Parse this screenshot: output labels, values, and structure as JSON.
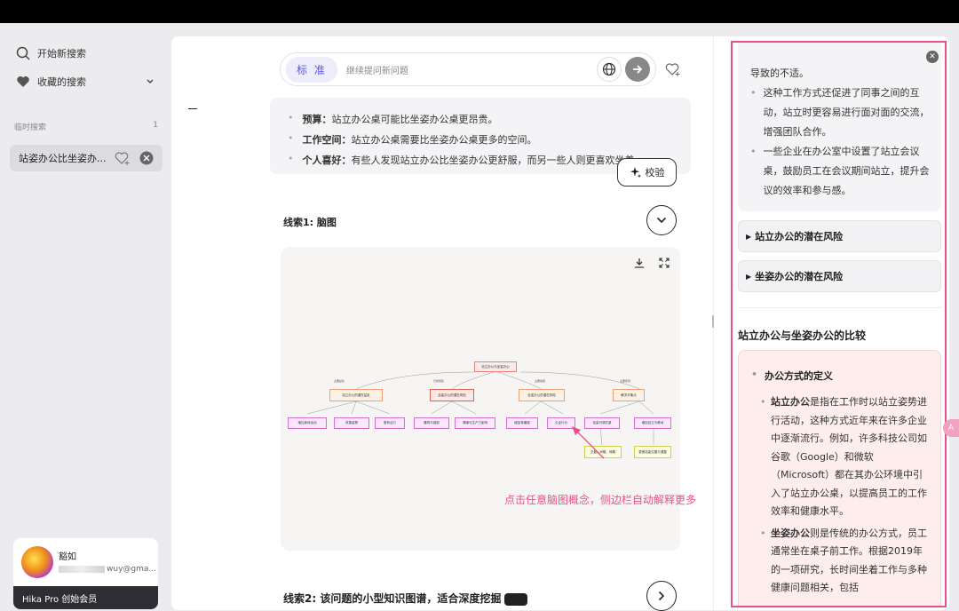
{
  "sidebar": {
    "new_search": "开始新搜索",
    "favorites": "收藏的搜索",
    "temp_section": "临时搜索",
    "temp_count": "1",
    "item_label": "站姿办公比坐姿办...",
    "user_name": "豁如",
    "user_email": "wuy@gma...",
    "pro_label": "Hika Pro 创始会员"
  },
  "search": {
    "mode_tag": "标 准",
    "placeholder": "继续提问新问题"
  },
  "info": {
    "items": [
      {
        "key": "预算：",
        "text": "站立办公桌可能比坐姿办公桌更昂贵。"
      },
      {
        "key": "工作空间：",
        "text": "站立办公桌需要比坐姿办公桌更多的空间。"
      },
      {
        "key": "个人喜好：",
        "text": "有些人发现站立办公比坐姿办公更舒服，而另一些人则更喜欢坐着。"
      }
    ],
    "verify_label": "校验"
  },
  "clue1": {
    "title": "线索1: 脑图"
  },
  "annotation": "点击任意脑图概念，侧边栏自动解释更多",
  "clue2": {
    "title": "线索2: 该问题的小型知识图谱，适合深度挖掘"
  },
  "right_panel": {
    "top_text": "导致的不适。",
    "top_items": [
      "这种工作方式还促进了同事之间的互动，站立时更容易进行面对面的交流，增强团队合作。",
      "一些企业在办公室中设置了站立会议桌，鼓励员工在会议期间站立，提升会议的效率和参与感。"
    ],
    "acc1": "站立办公的潜在风险",
    "acc2": "坐姿办公的潜在风险",
    "heading": "站立办公与坐姿办公的比较",
    "sub_heading": "办公方式的定义",
    "para1_bold": "站立办公",
    "para1_text": "是指在工作时以站立姿势进行活动，这种方式近年来在许多企业中逐渐流行。例如，许多科技公司如谷歌（Google）和微软（Microsoft）都在其办公环境中引入了站立办公桌，以提高员工的工作效率和健康水平。",
    "para2_bold": "坐姿办公",
    "para2_text": "则是传统的办公方式，员工通常坐在桌子前工作。根据2019年的一项研究，长时间坐着工作与多种健康问题相关，包括"
  },
  "mindmap": {
    "root": "站立办公与坐姿办公",
    "level1": [
      "站立办公的潜在益处",
      "坐姿办公的潜在风险",
      "坐姿办公的潜在风险",
      "解决平衡点"
    ],
    "edge1": [
      "主要益处",
      "日常误区",
      "主要健康",
      "主要原则"
    ],
    "level2": [
      "增加身体活动",
      "改善姿势",
      "更有活力",
      "腰背与颈部",
      "健康与生产力影响",
      "增加背痛感",
      "久坐行为",
      "站姿可调式桌",
      "增加站立与移动"
    ],
    "level3": [
      "交替、间歇、伸展",
      "更换站姿位置与调整"
    ],
    "colors": {
      "root": "#e8a0a0",
      "level1": "#f0a070",
      "level2": "#d070d0",
      "level3": "#d0d050"
    }
  },
  "colors": {
    "accent": "#e8518a",
    "tag": "#5b5bd6"
  }
}
